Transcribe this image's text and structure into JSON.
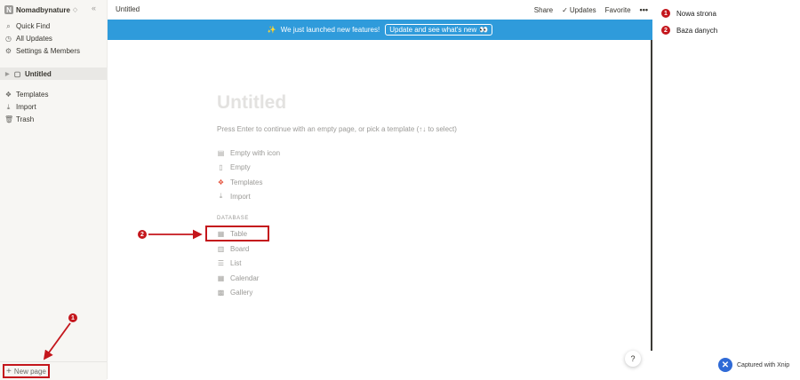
{
  "sidebar": {
    "workspace_badge": "N",
    "workspace_name": "Nomadbynature",
    "workspace_chevron": "◇",
    "collapse_icon": "«",
    "top_items": [
      {
        "label": "Quick Find",
        "icon": "search-icon",
        "glyph": "⌕"
      },
      {
        "label": "All Updates",
        "icon": "clock-icon",
        "glyph": "◷"
      },
      {
        "label": "Settings & Members",
        "icon": "gear-icon",
        "glyph": "⚙"
      }
    ],
    "page": {
      "label": "Untitled",
      "expand_glyph": "▶",
      "glyph": "▢"
    },
    "bottom_items": [
      {
        "label": "Templates",
        "icon": "templates-icon",
        "glyph": "❖"
      },
      {
        "label": "Import",
        "icon": "download-icon",
        "glyph": "⤓"
      },
      {
        "label": "Trash",
        "icon": "trash-icon",
        "glyph": "🗑"
      }
    ],
    "new_page": {
      "label": "New page",
      "glyph": "+"
    }
  },
  "topbar": {
    "title": "Untitled",
    "share": "Share",
    "updates": "Updates",
    "favorite": "Favorite",
    "more": "•••"
  },
  "banner": {
    "text": "We just launched new features!",
    "button": "Update and see what's new",
    "button_emoji": "👀",
    "sparkle": "✨"
  },
  "main": {
    "title": "Untitled",
    "hint": "Press Enter to continue with an empty page, or pick a template (↑↓ to select)",
    "options": [
      {
        "label": "Empty with icon",
        "icon": "page-with-icon-icon",
        "glyph": "▤"
      },
      {
        "label": "Empty",
        "icon": "page-icon",
        "glyph": "▯"
      },
      {
        "label": "Templates",
        "icon": "templates-icon",
        "glyph": "❖"
      },
      {
        "label": "Import",
        "icon": "download-icon",
        "glyph": "⤓"
      }
    ],
    "database_label": "DATABASE",
    "database_options": [
      {
        "label": "Table",
        "icon": "table-icon",
        "glyph": "▦"
      },
      {
        "label": "Board",
        "icon": "board-icon",
        "glyph": "▥"
      },
      {
        "label": "List",
        "icon": "list-icon",
        "glyph": "☰"
      },
      {
        "label": "Calendar",
        "icon": "calendar-icon",
        "glyph": "▦"
      },
      {
        "label": "Gallery",
        "icon": "gallery-icon",
        "glyph": "▩"
      }
    ],
    "help": "?"
  },
  "annotations": {
    "items": [
      {
        "num": "1",
        "label": "Nowa strona"
      },
      {
        "num": "2",
        "label": "Baza danych"
      }
    ],
    "captured": "Captured with Xnip",
    "color": "#c4161c"
  }
}
